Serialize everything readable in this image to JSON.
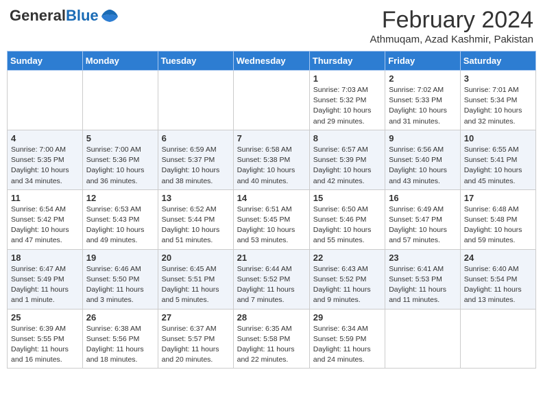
{
  "header": {
    "logo_general": "General",
    "logo_blue": "Blue",
    "month_year": "February 2024",
    "location": "Athmuqam, Azad Kashmir, Pakistan"
  },
  "days_of_week": [
    "Sunday",
    "Monday",
    "Tuesday",
    "Wednesday",
    "Thursday",
    "Friday",
    "Saturday"
  ],
  "weeks": [
    [
      {
        "day": "",
        "info": ""
      },
      {
        "day": "",
        "info": ""
      },
      {
        "day": "",
        "info": ""
      },
      {
        "day": "",
        "info": ""
      },
      {
        "day": "1",
        "info": "Sunrise: 7:03 AM\nSunset: 5:32 PM\nDaylight: 10 hours\nand 29 minutes."
      },
      {
        "day": "2",
        "info": "Sunrise: 7:02 AM\nSunset: 5:33 PM\nDaylight: 10 hours\nand 31 minutes."
      },
      {
        "day": "3",
        "info": "Sunrise: 7:01 AM\nSunset: 5:34 PM\nDaylight: 10 hours\nand 32 minutes."
      }
    ],
    [
      {
        "day": "4",
        "info": "Sunrise: 7:00 AM\nSunset: 5:35 PM\nDaylight: 10 hours\nand 34 minutes."
      },
      {
        "day": "5",
        "info": "Sunrise: 7:00 AM\nSunset: 5:36 PM\nDaylight: 10 hours\nand 36 minutes."
      },
      {
        "day": "6",
        "info": "Sunrise: 6:59 AM\nSunset: 5:37 PM\nDaylight: 10 hours\nand 38 minutes."
      },
      {
        "day": "7",
        "info": "Sunrise: 6:58 AM\nSunset: 5:38 PM\nDaylight: 10 hours\nand 40 minutes."
      },
      {
        "day": "8",
        "info": "Sunrise: 6:57 AM\nSunset: 5:39 PM\nDaylight: 10 hours\nand 42 minutes."
      },
      {
        "day": "9",
        "info": "Sunrise: 6:56 AM\nSunset: 5:40 PM\nDaylight: 10 hours\nand 43 minutes."
      },
      {
        "day": "10",
        "info": "Sunrise: 6:55 AM\nSunset: 5:41 PM\nDaylight: 10 hours\nand 45 minutes."
      }
    ],
    [
      {
        "day": "11",
        "info": "Sunrise: 6:54 AM\nSunset: 5:42 PM\nDaylight: 10 hours\nand 47 minutes."
      },
      {
        "day": "12",
        "info": "Sunrise: 6:53 AM\nSunset: 5:43 PM\nDaylight: 10 hours\nand 49 minutes."
      },
      {
        "day": "13",
        "info": "Sunrise: 6:52 AM\nSunset: 5:44 PM\nDaylight: 10 hours\nand 51 minutes."
      },
      {
        "day": "14",
        "info": "Sunrise: 6:51 AM\nSunset: 5:45 PM\nDaylight: 10 hours\nand 53 minutes."
      },
      {
        "day": "15",
        "info": "Sunrise: 6:50 AM\nSunset: 5:46 PM\nDaylight: 10 hours\nand 55 minutes."
      },
      {
        "day": "16",
        "info": "Sunrise: 6:49 AM\nSunset: 5:47 PM\nDaylight: 10 hours\nand 57 minutes."
      },
      {
        "day": "17",
        "info": "Sunrise: 6:48 AM\nSunset: 5:48 PM\nDaylight: 10 hours\nand 59 minutes."
      }
    ],
    [
      {
        "day": "18",
        "info": "Sunrise: 6:47 AM\nSunset: 5:49 PM\nDaylight: 11 hours\nand 1 minute."
      },
      {
        "day": "19",
        "info": "Sunrise: 6:46 AM\nSunset: 5:50 PM\nDaylight: 11 hours\nand 3 minutes."
      },
      {
        "day": "20",
        "info": "Sunrise: 6:45 AM\nSunset: 5:51 PM\nDaylight: 11 hours\nand 5 minutes."
      },
      {
        "day": "21",
        "info": "Sunrise: 6:44 AM\nSunset: 5:52 PM\nDaylight: 11 hours\nand 7 minutes."
      },
      {
        "day": "22",
        "info": "Sunrise: 6:43 AM\nSunset: 5:52 PM\nDaylight: 11 hours\nand 9 minutes."
      },
      {
        "day": "23",
        "info": "Sunrise: 6:41 AM\nSunset: 5:53 PM\nDaylight: 11 hours\nand 11 minutes."
      },
      {
        "day": "24",
        "info": "Sunrise: 6:40 AM\nSunset: 5:54 PM\nDaylight: 11 hours\nand 13 minutes."
      }
    ],
    [
      {
        "day": "25",
        "info": "Sunrise: 6:39 AM\nSunset: 5:55 PM\nDaylight: 11 hours\nand 16 minutes."
      },
      {
        "day": "26",
        "info": "Sunrise: 6:38 AM\nSunset: 5:56 PM\nDaylight: 11 hours\nand 18 minutes."
      },
      {
        "day": "27",
        "info": "Sunrise: 6:37 AM\nSunset: 5:57 PM\nDaylight: 11 hours\nand 20 minutes."
      },
      {
        "day": "28",
        "info": "Sunrise: 6:35 AM\nSunset: 5:58 PM\nDaylight: 11 hours\nand 22 minutes."
      },
      {
        "day": "29",
        "info": "Sunrise: 6:34 AM\nSunset: 5:59 PM\nDaylight: 11 hours\nand 24 minutes."
      },
      {
        "day": "",
        "info": ""
      },
      {
        "day": "",
        "info": ""
      }
    ]
  ]
}
